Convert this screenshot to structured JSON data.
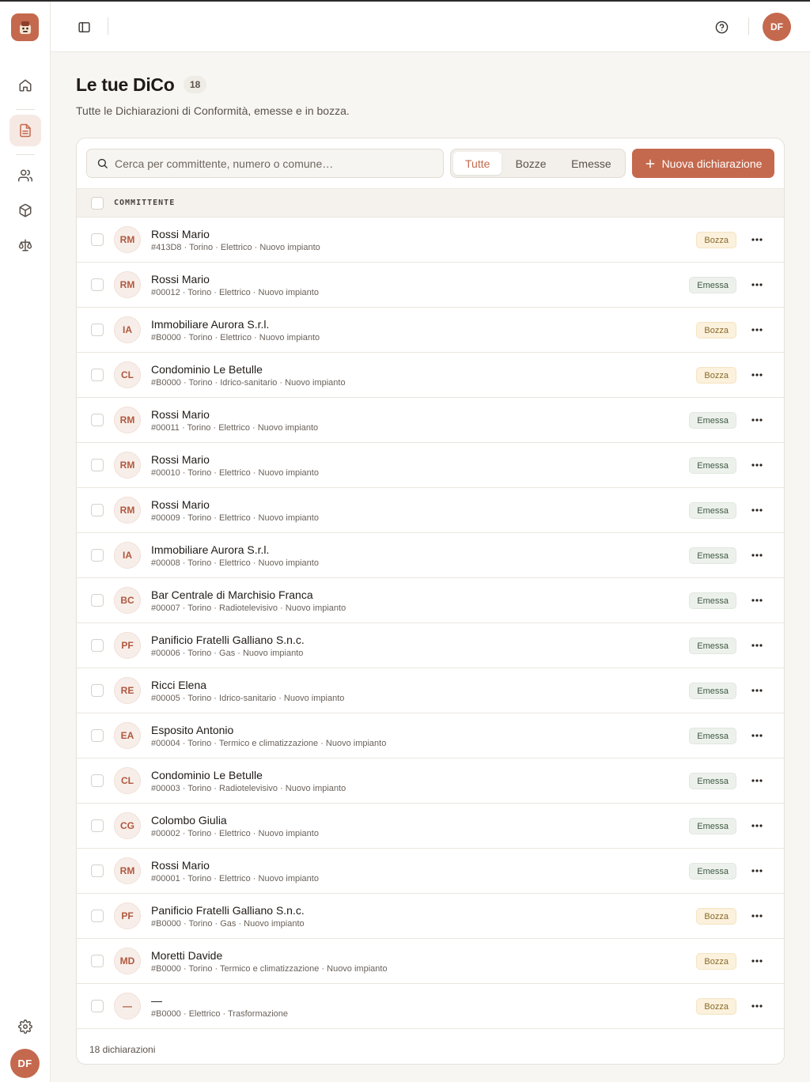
{
  "sidebar": {
    "nav": [
      {
        "icon": "home-icon"
      },
      {
        "icon": "document-icon",
        "active": true
      },
      {
        "icon": "users-icon"
      },
      {
        "icon": "package-icon"
      },
      {
        "icon": "scale-icon"
      }
    ],
    "settings_icon": "gear-icon",
    "user_initials": "DF"
  },
  "topbar": {
    "toggle_icon": "sidebar-toggle-icon",
    "help_icon": "help-icon",
    "user_initials": "DF"
  },
  "header": {
    "title": "Le tue DiCo",
    "count": "18",
    "subtitle": "Tutte le Dichiarazioni di Conformità, emesse e in bozza."
  },
  "toolbar": {
    "search_placeholder": "Cerca per committente, numero o comune…",
    "filters": [
      "Tutte",
      "Bozze",
      "Emesse"
    ],
    "active_filter": "Tutte",
    "new_button": "Nuova dichiarazione"
  },
  "table": {
    "column_header": "COMMITTENTE",
    "rows": [
      {
        "initials": "RM",
        "name": "Rossi Mario",
        "meta": "#413D8 · Torino · Elettrico · Nuovo impianto",
        "status": "Bozza"
      },
      {
        "initials": "RM",
        "name": "Rossi Mario",
        "meta": "#00012 · Torino · Elettrico · Nuovo impianto",
        "status": "Emessa"
      },
      {
        "initials": "IA",
        "name": "Immobiliare Aurora S.r.l.",
        "meta": "#B0000 · Torino · Elettrico · Nuovo impianto",
        "status": "Bozza"
      },
      {
        "initials": "CL",
        "name": "Condominio Le Betulle",
        "meta": "#B0000 · Torino · Idrico-sanitario · Nuovo impianto",
        "status": "Bozza"
      },
      {
        "initials": "RM",
        "name": "Rossi Mario",
        "meta": "#00011 · Torino · Elettrico · Nuovo impianto",
        "status": "Emessa"
      },
      {
        "initials": "RM",
        "name": "Rossi Mario",
        "meta": "#00010 · Torino · Elettrico · Nuovo impianto",
        "status": "Emessa"
      },
      {
        "initials": "RM",
        "name": "Rossi Mario",
        "meta": "#00009 · Torino · Elettrico · Nuovo impianto",
        "status": "Emessa"
      },
      {
        "initials": "IA",
        "name": "Immobiliare Aurora S.r.l.",
        "meta": "#00008 · Torino · Elettrico · Nuovo impianto",
        "status": "Emessa"
      },
      {
        "initials": "BC",
        "name": "Bar Centrale di Marchisio Franca",
        "meta": "#00007 · Torino · Radiotelevisivo · Nuovo impianto",
        "status": "Emessa"
      },
      {
        "initials": "PF",
        "name": "Panificio Fratelli Galliano S.n.c.",
        "meta": "#00006 · Torino · Gas · Nuovo impianto",
        "status": "Emessa"
      },
      {
        "initials": "RE",
        "name": "Ricci Elena",
        "meta": "#00005 · Torino · Idrico-sanitario · Nuovo impianto",
        "status": "Emessa"
      },
      {
        "initials": "EA",
        "name": "Esposito Antonio",
        "meta": "#00004 · Torino · Termico e climatizzazione · Nuovo impianto",
        "status": "Emessa"
      },
      {
        "initials": "CL",
        "name": "Condominio Le Betulle",
        "meta": "#00003 · Torino · Radiotelevisivo · Nuovo impianto",
        "status": "Emessa"
      },
      {
        "initials": "CG",
        "name": "Colombo Giulia",
        "meta": "#00002 · Torino · Elettrico · Nuovo impianto",
        "status": "Emessa"
      },
      {
        "initials": "RM",
        "name": "Rossi Mario",
        "meta": "#00001 · Torino · Elettrico · Nuovo impianto",
        "status": "Emessa"
      },
      {
        "initials": "PF",
        "name": "Panificio Fratelli Galliano S.n.c.",
        "meta": "#B0000 · Torino · Gas · Nuovo impianto",
        "status": "Bozza"
      },
      {
        "initials": "MD",
        "name": "Moretti Davide",
        "meta": "#B0000 · Torino · Termico e climatizzazione · Nuovo impianto",
        "status": "Bozza"
      },
      {
        "initials": "—",
        "name": "—",
        "meta": "#B0000 · Elettrico · Trasformazione",
        "status": "Bozza"
      }
    ],
    "footer": "18 dichiarazioni"
  },
  "colors": {
    "accent": "#c4694e",
    "bozza_bg": "#fbf1dc",
    "emessa_bg": "#edf1ec"
  }
}
